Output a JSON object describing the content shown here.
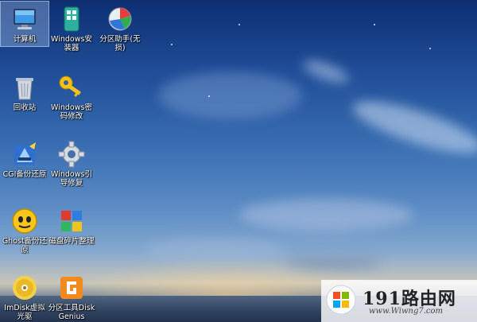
{
  "desktop": {
    "icons": [
      {
        "label": "计算机",
        "icon": "computer-icon",
        "selected": true
      },
      {
        "label": "Windows安装器",
        "icon": "windows-installer-icon",
        "selected": false
      },
      {
        "label": "分区助手(无损)",
        "icon": "partition-assistant-icon",
        "selected": false
      },
      {
        "label": "回收站",
        "icon": "recycle-bin-icon",
        "selected": false
      },
      {
        "label": "Windows密码修改",
        "icon": "key-icon",
        "selected": false
      },
      {
        "label": "CGI备份还原",
        "icon": "cgi-backup-icon",
        "selected": false
      },
      {
        "label": "Windows引导修复",
        "icon": "gear-icon",
        "selected": false
      },
      {
        "label": "Ghost备份还原",
        "icon": "ghost-icon",
        "selected": false
      },
      {
        "label": "磁盘碎片整理",
        "icon": "defrag-icon",
        "selected": false
      },
      {
        "label": "ImDisk虚拟光驱",
        "icon": "virtual-drive-icon",
        "selected": false
      },
      {
        "label": "分区工具DiskGenius",
        "icon": "diskgenius-icon",
        "selected": false
      }
    ]
  },
  "watermark": {
    "brand": "191路由网",
    "url": "www.Wiwng7.com",
    "logo_icon": "windows-logo-icon"
  }
}
